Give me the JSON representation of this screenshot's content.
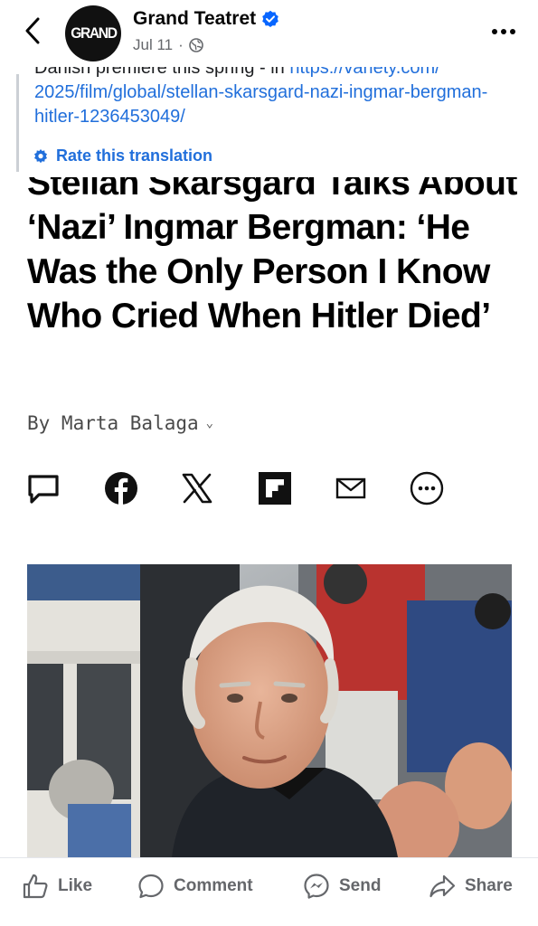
{
  "post_header": {
    "page_name": "Grand Teatret",
    "avatar_text": "GRAND",
    "date": "Jul 11",
    "separator": "·",
    "verified": true
  },
  "caption": {
    "line1": "Danish premiere this spring - in ",
    "link_start": "https://variety.com/",
    "link_rest": "2025/film/global/stellan-skarsgard-nazi-ingmar-bergman-hitler-1236453049/",
    "rate_translation": "Rate this translation"
  },
  "article": {
    "headline": "Stellan Skarsgård Talks About ‘Nazi’ Ingmar Bergman: ‘He Was the Only Person I Know Who Cried When Hitler Died’",
    "byline": "By Marta Balaga",
    "byline_chevron": "⌄"
  },
  "share_icons": [
    "comment-icon",
    "facebook-icon",
    "x-icon",
    "flipboard-icon",
    "email-icon",
    "more-icon"
  ],
  "actions": {
    "like": "Like",
    "comment": "Comment",
    "send": "Send",
    "share": "Share"
  },
  "colors": {
    "link": "#216fdb",
    "verified": "#0866ff",
    "muted": "#65676b"
  }
}
